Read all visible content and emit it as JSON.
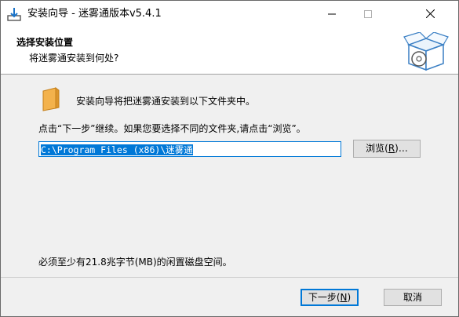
{
  "window": {
    "title": "安装向导 - 迷雾通版本v5.4.1",
    "controls": {
      "minimize_icon": "minimize-icon",
      "maximize_icon": "maximize-icon",
      "close_icon": "close-icon"
    }
  },
  "header": {
    "title": "选择安装位置",
    "subtitle": "将迷雾通安装到何处?"
  },
  "body": {
    "intro": "安装向导将把迷雾通安装到以下文件夹中。",
    "instruction": "点击“下一步”继续。如果您要选择不同的文件夹,请点击“浏览”。",
    "path_value": "C:\\Program Files (x86)\\迷雾通",
    "browse_label": "浏览",
    "browse_key": "R",
    "browse_suffix": "…",
    "space_required": "必须至少有21.8兆字节(MB)的闲置磁盘空间。"
  },
  "footer": {
    "next_label": "下一步",
    "next_key": "N",
    "cancel_label": "取消"
  },
  "colors": {
    "accent": "#0078d7",
    "folder": "#e8a33c"
  }
}
